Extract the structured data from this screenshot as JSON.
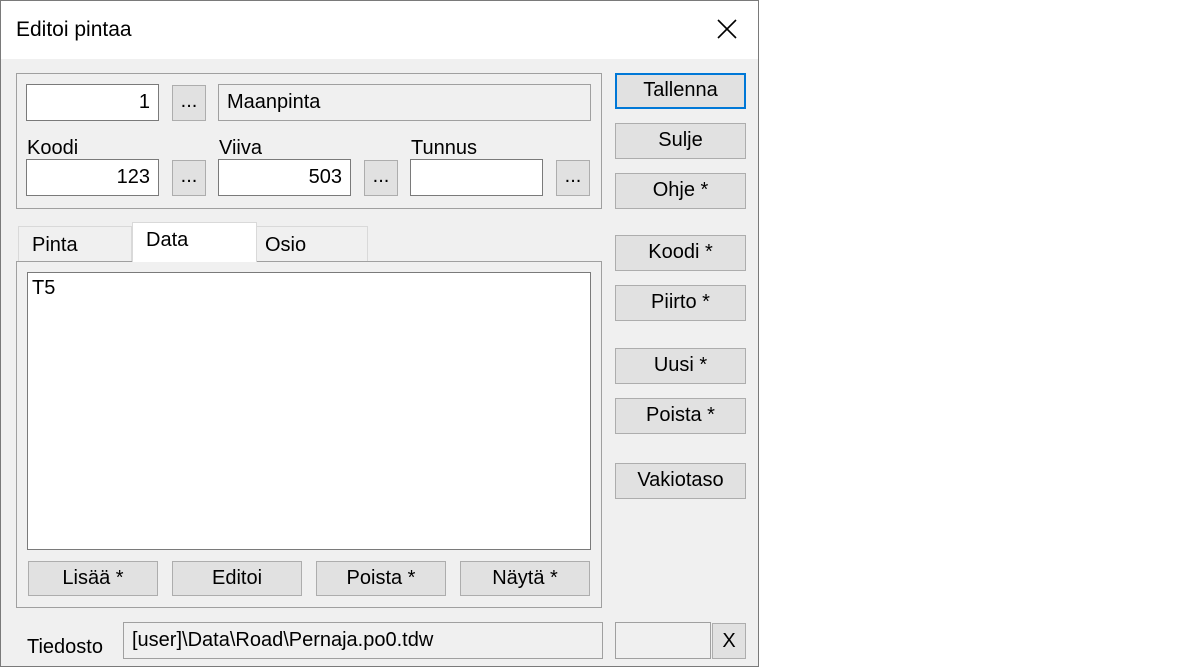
{
  "window": {
    "title": "Editoi pintaa"
  },
  "surface": {
    "number": "1",
    "name": "Maanpinta",
    "browse_label": "..."
  },
  "fields": {
    "koodi": {
      "label": "Koodi",
      "value": "123"
    },
    "viiva": {
      "label": "Viiva",
      "value": "503"
    },
    "tunnus": {
      "label": "Tunnus",
      "value": ""
    },
    "browse_label": "..."
  },
  "tabs": [
    {
      "label": "Pinta"
    },
    {
      "label": "Data"
    },
    {
      "label": "Osio"
    }
  ],
  "data_list": {
    "items": [
      "T5"
    ]
  },
  "list_buttons": {
    "add": "Lisää *",
    "edit": "Editoi",
    "remove": "Poista *",
    "show": "Näytä *"
  },
  "side_buttons": {
    "save": "Tallenna",
    "close": "Sulje",
    "help": "Ohje *",
    "code": "Koodi *",
    "draw": "Piirto *",
    "new": "Uusi *",
    "delete": "Poista *",
    "level": "Vakiotaso"
  },
  "file": {
    "label": "Tiedosto",
    "path": "[user]\\Data\\Road\\Pernaja.po0.tdw",
    "extra": "",
    "clear_label": "X"
  }
}
